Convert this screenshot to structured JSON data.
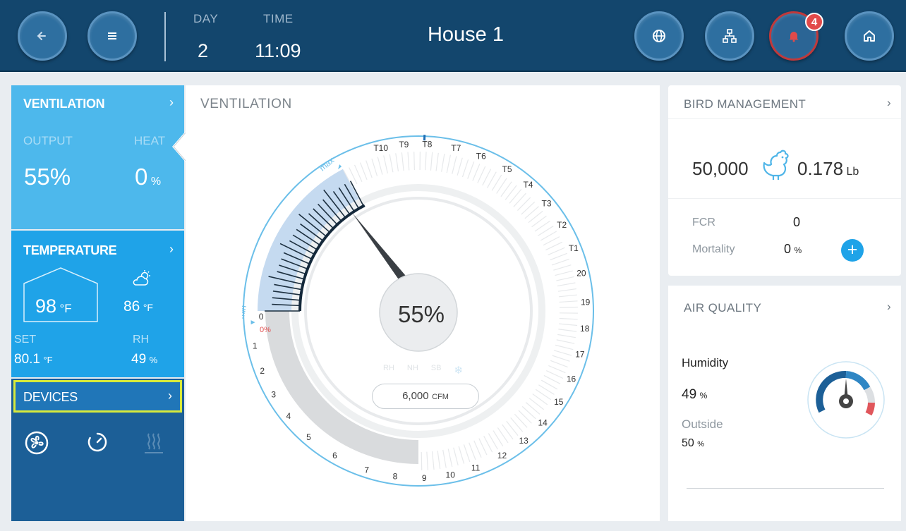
{
  "topbar": {
    "day_label": "DAY",
    "day_value": "2",
    "time_label": "TIME",
    "time_value": "11:09",
    "house_title": "House 1",
    "alarm_count": "4",
    "icons": [
      "back-arrow-icon",
      "menu-icon",
      "globe-icon",
      "network-icon",
      "alarm-bell-icon",
      "home-icon"
    ]
  },
  "ventilation_card": {
    "title": "VENTILATION",
    "chevron": "›",
    "output_label": "OUTPUT",
    "heat_label": "HEAT",
    "output_value": "55%",
    "heat_value": "0",
    "heat_unit": "%"
  },
  "temperature_card": {
    "title": "TEMPERATURE",
    "chevron": "›",
    "inside_value": "98",
    "inside_unit": "°F",
    "outside_value": "86",
    "outside_unit": "°F",
    "set_label": "SET",
    "set_value": "80.1",
    "set_unit": "°F",
    "rh_label": "RH",
    "rh_value": "49",
    "rh_unit": "%"
  },
  "devices_card": {
    "title": "DEVICES",
    "chevron": "›",
    "icons": [
      "fan-icon",
      "timer-icon",
      "heater-icon"
    ]
  },
  "center": {
    "title": "VENTILATION",
    "dial_value": "55%",
    "cfm_value": "6,000",
    "cfm_unit": "CFM",
    "min_label": "min",
    "max_label": "max",
    "zero_percent_label": "0%",
    "output_percent": 55,
    "level_labels": [
      "0",
      "1",
      "2",
      "3",
      "4",
      "5",
      "6",
      "7",
      "8",
      "9",
      "10",
      "11",
      "12",
      "13",
      "14",
      "15",
      "16",
      "17",
      "18",
      "19",
      "20",
      "T1",
      "T2",
      "T3",
      "T4",
      "T5",
      "T6",
      "T7",
      "T8",
      "T9",
      "T10"
    ],
    "stage_labels": [
      "RH",
      "NH",
      "SB"
    ]
  },
  "bird_management": {
    "title": "BIRD MANAGEMENT",
    "chevron": "›",
    "bird_count": "50,000",
    "weight_value": "0.178",
    "weight_unit": "Lb",
    "fcr_label": "FCR",
    "fcr_value": "0",
    "mortality_label": "Mortality",
    "mortality_value": "0",
    "mortality_unit": "%",
    "add_symbol": "+"
  },
  "air_quality": {
    "title": "AIR QUALITY",
    "chevron": "›",
    "humidity_label": "Humidity",
    "humidity_value": "49",
    "humidity_unit": "%",
    "outside_label": "Outside",
    "outside_value": "50",
    "outside_unit": "%"
  },
  "colors": {
    "topbar": "#13466d",
    "ventilation_card": "#4db8ec",
    "temperature_card": "#1fa3e8",
    "devices_card": "#1c5f97",
    "devices_highlight": "#d8ea3a",
    "alarm_ring": "#c0393b"
  }
}
